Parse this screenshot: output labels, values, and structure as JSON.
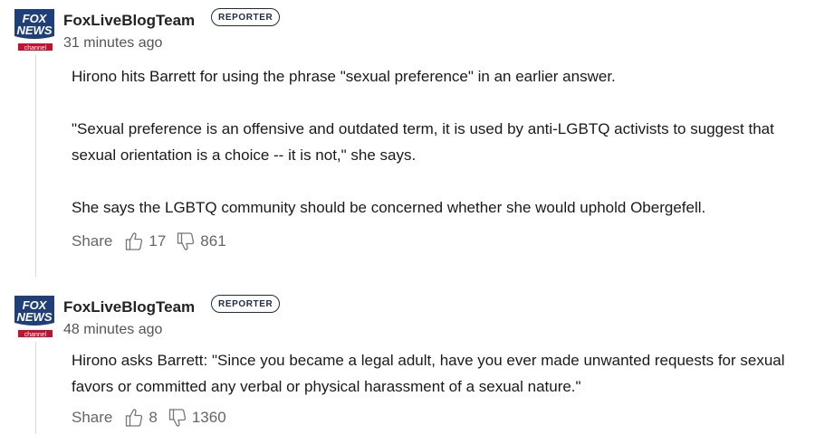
{
  "posts": [
    {
      "author": "FoxLiveBlogTeam",
      "badge": "REPORTER",
      "time": "31 minutes ago",
      "paragraphs": [
        "Hirono hits Barrett for using the phrase \"sexual preference\" in an earlier answer.",
        "\"Sexual preference is an offensive and outdated term, it is used by anti-LGBTQ activists to suggest that sexual orientation is a choice -- it is not,\" she says.",
        "She says the LGBTQ community should be concerned whether she would uphold Obergefell."
      ],
      "share_label": "Share",
      "likes": "17",
      "dislikes": "861"
    },
    {
      "author": "FoxLiveBlogTeam",
      "badge": "REPORTER",
      "time": "48 minutes ago",
      "paragraphs": [
        "Hirono asks Barrett: \"Since you became a legal adult, have you ever made unwanted requests for sexual favors or committed any verbal or physical harassment of a sexual nature.\""
      ],
      "share_label": "Share",
      "likes": "8",
      "dislikes": "1360"
    }
  ],
  "logo": {
    "line1": "FOX",
    "line2": "NEWS",
    "subtext": "channel"
  },
  "colors": {
    "logo_blue": "#1f3f7a",
    "logo_red": "#c8102e",
    "badge": "#1f2c46",
    "thread_line": "#d9d9d9",
    "muted": "#666666"
  },
  "icons": {
    "like": "thumbs-up-icon",
    "dislike": "thumbs-down-icon"
  }
}
